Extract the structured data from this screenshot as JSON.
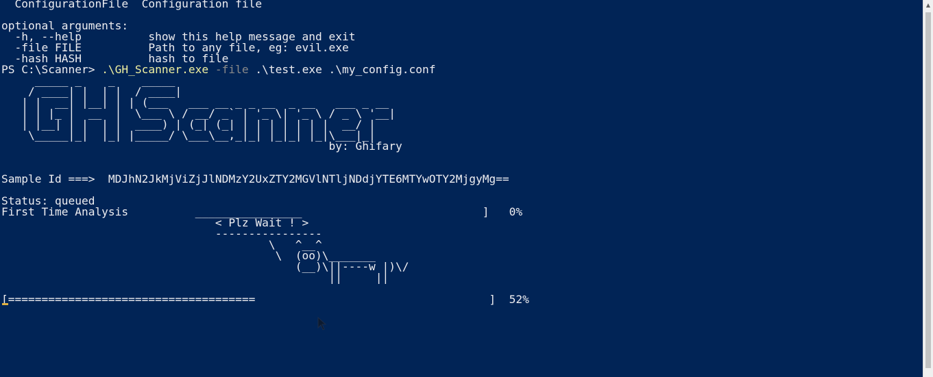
{
  "colors": {
    "background": "#012456",
    "foreground": "#eeedf0",
    "executable": "#f0f0a0",
    "parameter": "#8a8a8a",
    "cursor": "#e0b040"
  },
  "lines": {
    "positional_arg": "  ConfigurationFile  Configuration file",
    "blank1": "",
    "optional_header": "optional arguments:",
    "opt_help": "  -h, --help          show this help message and exit",
    "opt_file": "  -file FILE          Path to any file, eg: evil.exe",
    "opt_hash": "  -hash HASH          hash to file"
  },
  "command": {
    "prompt": "PS C:\\Scanner> ",
    "executable": ".\\GH_Scanner.exe",
    "flag": " -file ",
    "args": ".\\test.exe .\\my_config.conf"
  },
  "banner": {
    "art": [
      "     _____ _    _    _____",
      "    / ____| |  | |  / ____|",
      "   | |  __| |__| | | (___   ___ __ _ _ __  _ __   ___ _ __",
      "   | | |_ |  __  |  \\___ \\ / __/ _` | '_ \\| '_ \\ / _ \\ '__|",
      "   | |__| | |  | |  ____) | (_| (_| | | | | | | |  __/ |",
      "    \\_____|_|  |_| |_____/ \\___\\__,_|_| |_|_| |_|\\___|_|"
    ],
    "author": "                                                 by: Ghifary"
  },
  "sample": {
    "line": "Sample Id ===>  MDJhN2JkMjViZjJlNDMzY2UxZTY2MGVlNTljNDdjYTE6MTYwOTY2MjgyMg=="
  },
  "status": {
    "line": "Status: queued"
  },
  "analysis": {
    "line": "First Time Analysis          ________________                           ]   0%"
  },
  "cowsay": [
    "                                < Plz Wait ! >",
    "                                ----------------",
    "                                        \\   ^__^",
    "                                         \\  (oo)\\_______",
    "                                            (__)\\||----w |)\\/",
    "                                                 ||     ||"
  ],
  "progress": {
    "line": "[=====================================                                   ]  52%"
  }
}
